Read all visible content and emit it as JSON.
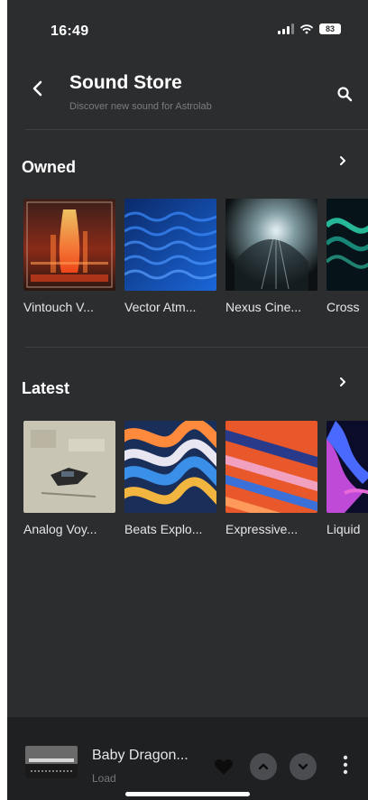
{
  "status_bar": {
    "time": "16:49",
    "battery": "83"
  },
  "header": {
    "title": "Sound Store",
    "subtitle": "Discover new sound for Astrolab"
  },
  "sections": [
    {
      "title": "Owned",
      "items": [
        {
          "label": "Vintouch V..."
        },
        {
          "label": "Vector Atm..."
        },
        {
          "label": "Nexus Cine..."
        },
        {
          "label": "Cross"
        }
      ]
    },
    {
      "title": "Latest",
      "items": [
        {
          "label": "Analog Voy..."
        },
        {
          "label": "Beats Explo..."
        },
        {
          "label": "Expressive..."
        },
        {
          "label": "Liquid"
        }
      ]
    }
  ],
  "player": {
    "title": "Baby Dragon...",
    "status": "Load"
  },
  "icons": {
    "back": "chevron-left-icon",
    "search": "search-icon",
    "section_more": "chevron-right-icon",
    "favorite": "heart-icon",
    "prev": "chevron-up-icon",
    "next": "chevron-down-icon",
    "menu": "more-vertical-icon"
  },
  "colors": {
    "background": "#2c2d2f",
    "player_bar": "#1f2022",
    "text": "#ffffff",
    "muted": "#7a7c80"
  }
}
